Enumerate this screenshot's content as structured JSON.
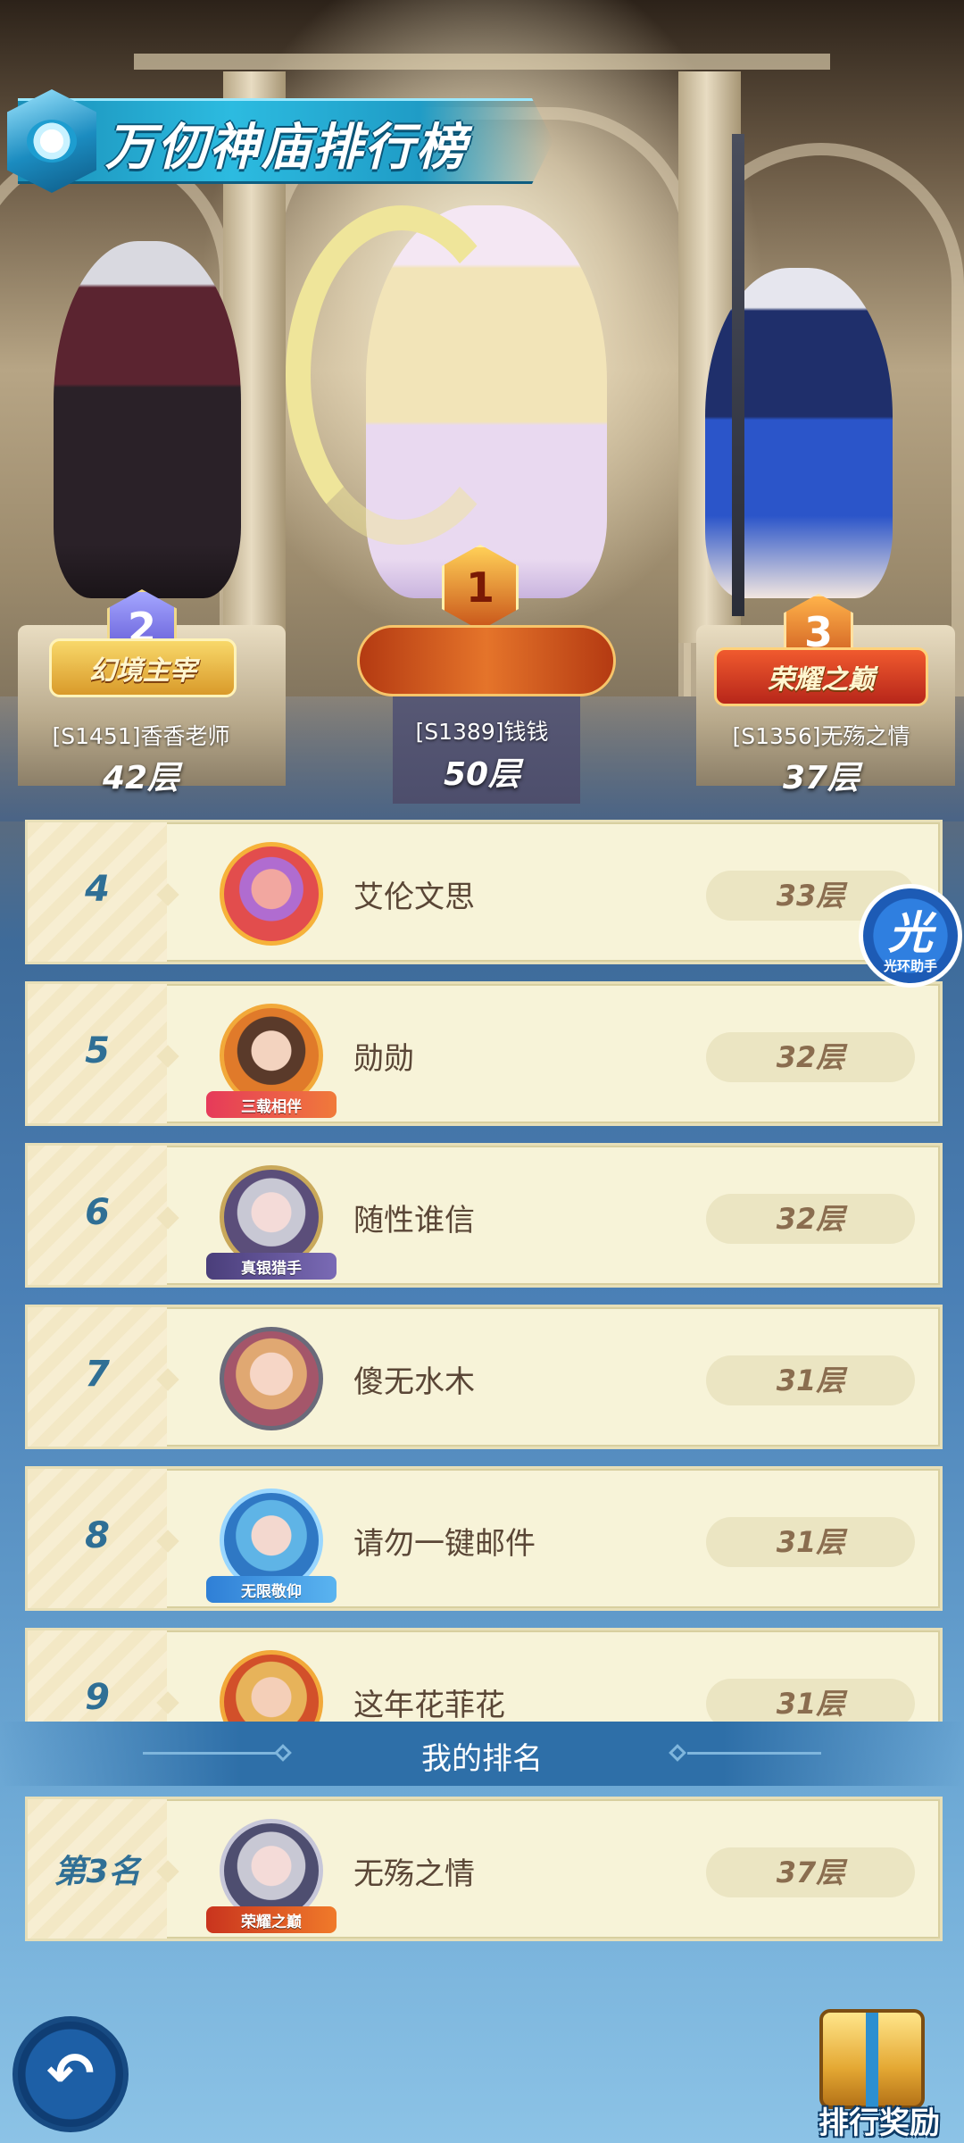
{
  "header": {
    "title": "万仞神庙排行榜"
  },
  "podium": [
    {
      "rank": "2",
      "title": "幻境主宰",
      "name": "[S1451]香香老师",
      "floor": "42层"
    },
    {
      "rank": "1",
      "title": "",
      "name": "[S1389]钱钱",
      "floor": "50层"
    },
    {
      "rank": "3",
      "title": "荣耀之巅",
      "name": "[S1356]无殇之情",
      "floor": "37层"
    }
  ],
  "ranking": [
    {
      "rank": "4",
      "name": "艾伦文思",
      "floor": "33层",
      "badge": ""
    },
    {
      "rank": "5",
      "name": "勋勋",
      "floor": "32层",
      "badge": "三载相伴"
    },
    {
      "rank": "6",
      "name": "随性谁信",
      "floor": "32层",
      "badge": "真银猎手"
    },
    {
      "rank": "7",
      "name": "傻无水木",
      "floor": "31层",
      "badge": ""
    },
    {
      "rank": "8",
      "name": "请勿一键邮件",
      "floor": "31层",
      "badge": "无限敬仰"
    },
    {
      "rank": "9",
      "name": "这年花菲花",
      "floor": "31层",
      "badge": ""
    }
  ],
  "my_rank": {
    "header": "我的排名",
    "rank": "第3名",
    "name": "无殇之情",
    "floor": "37层",
    "badge": "荣耀之巅"
  },
  "assist": {
    "glyph": "光",
    "label": "光环助手"
  },
  "footer": {
    "back_glyph": "↶",
    "reward_label": "排行奖励"
  }
}
